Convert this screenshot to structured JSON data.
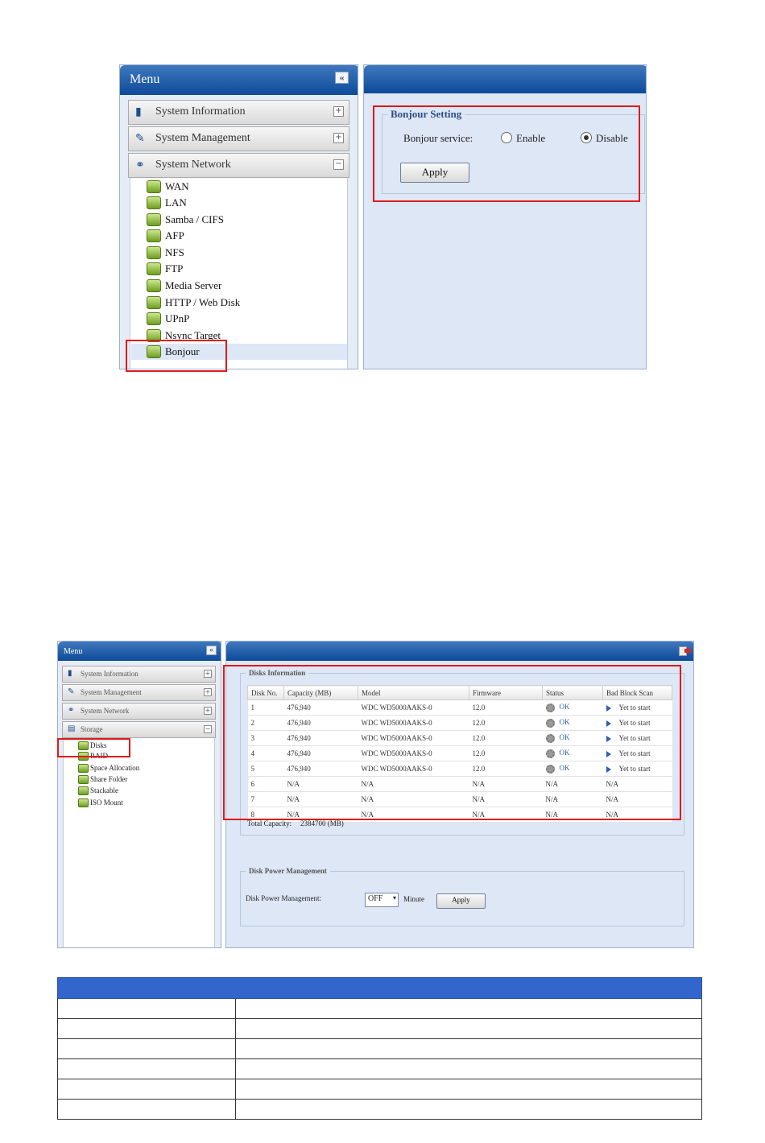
{
  "screen1": {
    "menu": {
      "title": "Menu",
      "collapse_glyph": "«",
      "categories": [
        {
          "label": "System Information",
          "toggle": "+"
        },
        {
          "label": "System Management",
          "toggle": "+"
        },
        {
          "label": "System Network",
          "toggle": "−"
        }
      ],
      "network_items": [
        "WAN",
        "LAN",
        "Samba / CIFS",
        "AFP",
        "NFS",
        "FTP",
        "Media Server",
        "HTTP / Web Disk",
        "UPnP",
        "Nsync Target",
        "Bonjour"
      ]
    },
    "bonjour": {
      "legend": "Bonjour Setting",
      "service_label": "Bonjour service:",
      "enable_label": "Enable",
      "disable_label": "Disable",
      "selected": "Disable",
      "apply_label": "Apply"
    }
  },
  "screen2": {
    "menu": {
      "title": "Menu",
      "collapse_glyph": "«",
      "categories": [
        {
          "label": "System Information",
          "toggle": "+"
        },
        {
          "label": "System Management",
          "toggle": "+"
        },
        {
          "label": "System Network",
          "toggle": "+"
        },
        {
          "label": "Storage",
          "toggle": "−"
        }
      ],
      "storage_items": [
        "Disks",
        "RAID",
        "Space Allocation",
        "Share Folder",
        "Stackable",
        "ISO Mount"
      ]
    },
    "disks": {
      "legend": "Disks Information",
      "columns": [
        "Disk No.",
        "Capacity (MB)",
        "Model",
        "Firmware",
        "Status",
        "Bad Block Scan"
      ],
      "rows": [
        [
          "1",
          "476,940",
          "WDC WD5000AAKS-0",
          "12.0",
          "OK",
          "Yet to start"
        ],
        [
          "2",
          "476,940",
          "WDC WD5000AAKS-0",
          "12.0",
          "OK",
          "Yet to start"
        ],
        [
          "3",
          "476,940",
          "WDC WD5000AAKS-0",
          "12.0",
          "OK",
          "Yet to start"
        ],
        [
          "4",
          "476,940",
          "WDC WD5000AAKS-0",
          "12.0",
          "OK",
          "Yet to start"
        ],
        [
          "5",
          "476,940",
          "WDC WD5000AAKS-0",
          "12.0",
          "OK",
          "Yet to start"
        ],
        [
          "6",
          "N/A",
          "N/A",
          "N/A",
          "N/A",
          "N/A"
        ],
        [
          "7",
          "N/A",
          "N/A",
          "N/A",
          "N/A",
          "N/A"
        ],
        [
          "8",
          "N/A",
          "N/A",
          "N/A",
          "N/A",
          "N/A"
        ]
      ],
      "total_label": "Total Capacity:",
      "total_value": "2384700 (MB)"
    },
    "power": {
      "legend": "Disk Power Management",
      "label": "Disk Power Management:",
      "value": "OFF",
      "unit": "Minute",
      "apply_label": "Apply"
    }
  },
  "colors": {
    "highlight": "#e01a1a",
    "header_blue": "#0d4a99",
    "panel_bg": "#dde7f5",
    "table_header": "#3366cc"
  }
}
